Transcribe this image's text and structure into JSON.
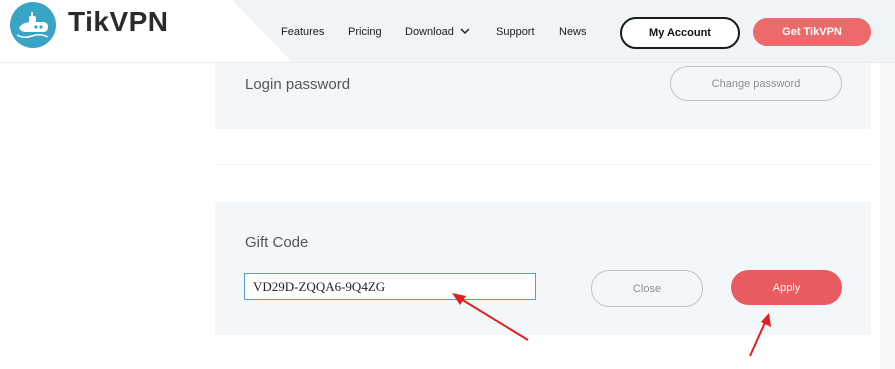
{
  "brand": {
    "name": "TikVPN",
    "logo_icon": "submarine-icon",
    "color": "#3aa4c6"
  },
  "nav": {
    "items": [
      {
        "label": "Features"
      },
      {
        "label": "Pricing"
      },
      {
        "label": "Download",
        "icon": "chevron-down-icon"
      },
      {
        "label": "Support"
      },
      {
        "label": "News"
      }
    ],
    "account_label": "My Account",
    "cta_label": "Get TikVPN",
    "cta_color": "#ec6a6a"
  },
  "login_section": {
    "label": "Login password",
    "button_label": "Change password"
  },
  "gift_section": {
    "title": "Gift Code",
    "input_value": "VD29D-ZQQA6-9Q4ZG",
    "close_label": "Close",
    "apply_label": "Apply",
    "apply_color": "#e85c5f"
  },
  "annotations": {
    "arrow_color": "#e02020"
  }
}
